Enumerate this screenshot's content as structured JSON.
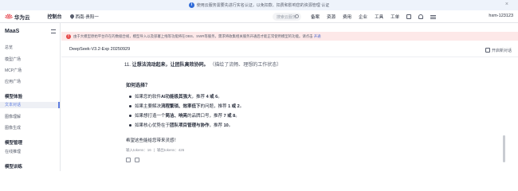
{
  "notice": {
    "text": "使用云服务需要先进行实名认证，以免扣款、扣费和影响您的资源管理 认证",
    "close": "×"
  },
  "topbar": {
    "brand": "华为云",
    "console": "控制台",
    "region": "西南-贵阳一",
    "search_placeholder": "搜索云服务",
    "nav": [
      "备案",
      "资源",
      "费用",
      "企业",
      "工具",
      "工单"
    ],
    "account": "hxm-123123"
  },
  "sidebar": {
    "title": "MaaS",
    "items": [
      {
        "label": "总览"
      },
      {
        "label": "模型广场"
      },
      {
        "label": "MCP广场"
      },
      {
        "label": "应用广场"
      }
    ],
    "section_experience": "模型体验",
    "experience_items": [
      {
        "label": "文本对话",
        "active": true
      },
      {
        "label": "图像理解"
      },
      {
        "label": "图像生成"
      }
    ],
    "section_manage": "模型管理",
    "manage_items": [
      {
        "label": "在线推理"
      }
    ],
    "section_train": "模型训练"
  },
  "banner": {
    "text": "由于大模型原始平台存在的数据合规，模型导入以及部署上线等功能将在OBS、SWR等服务，需求将收集相关服务开通后才能正常使用模型的功能。请点击",
    "link": "开通"
  },
  "chat": {
    "model_name": "DeepSeek-V3.2-Exp 20250929",
    "new_chat": "开启新对话",
    "item11_num": "11.",
    "item11_bold": "让想法流动起来，让团队高效协同。",
    "item11_rest": "（描绘了流畅、理想的工作状态）",
    "howto_title": "如何选择？",
    "bullets": [
      {
        "pre": "如果您的软件",
        "bold": "AI功能极其强大",
        "post": "，推荐 ",
        "num": "4 或 6",
        "end": "。"
      },
      {
        "pre": "如果主要解决",
        "bold": "流程繁琐、效率低下",
        "post": "的问题，推荐 ",
        "num": "1 或 2",
        "end": "。"
      },
      {
        "pre": "如果想打造一个",
        "bold": "简洁、响亮",
        "post": "的品牌口号，推荐 ",
        "num": "7 或 8",
        "end": "。"
      },
      {
        "pre": "如果核心优势在于",
        "bold": "团队项目管理与协作",
        "post": "，推荐 ",
        "num": "10",
        "end": "。"
      }
    ],
    "closing": "希望这些能给您带来灵感！",
    "tokens_in": "输入tokens：16",
    "tokens_out": "输出tokens：426"
  }
}
